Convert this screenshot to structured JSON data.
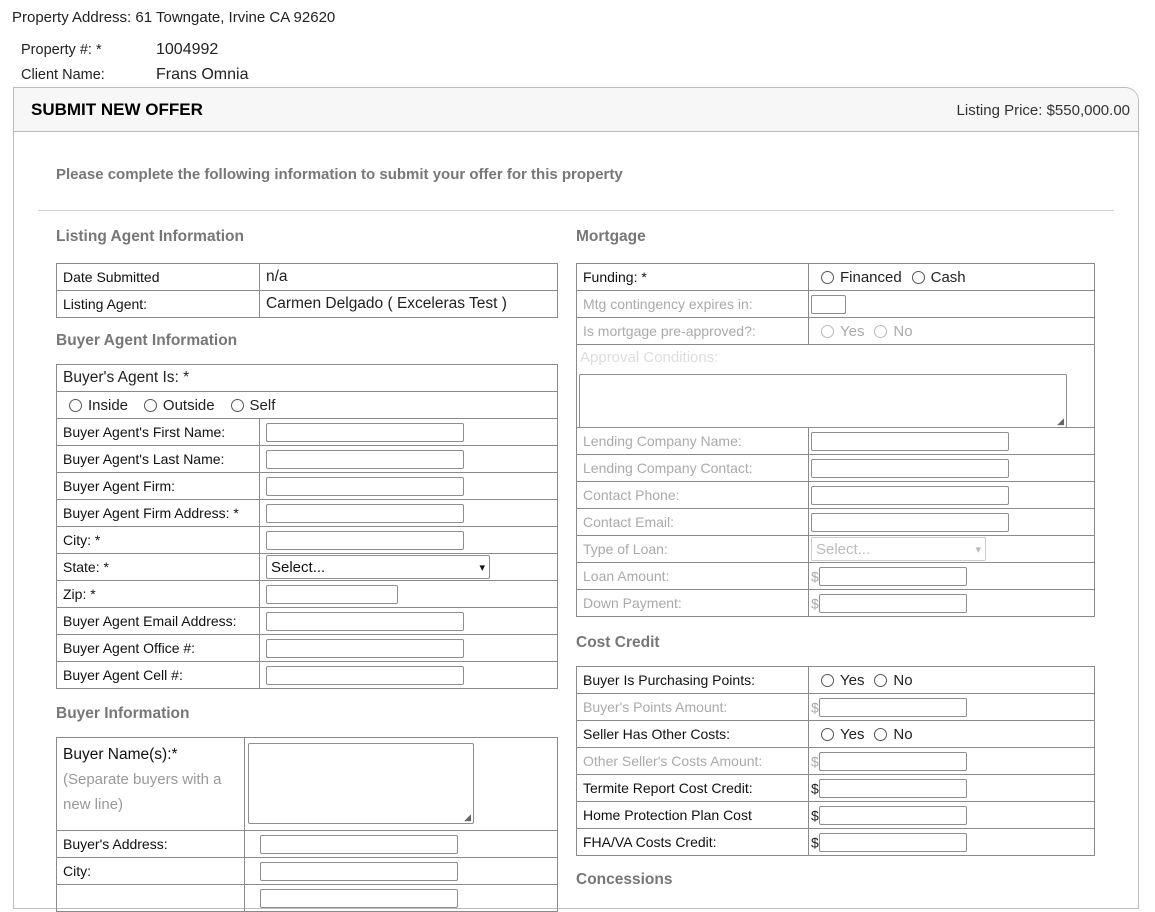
{
  "property": {
    "address_label": "Property Address:",
    "address": "61 Towngate, Irvine CA 92620",
    "number_label": "Property #: *",
    "number": "1004992",
    "client_label": "Client Name:",
    "client": "Frans Omnia"
  },
  "panel": {
    "title": "SUBMIT NEW OFFER",
    "listing_price": "Listing Price: $550,000.00",
    "intro": "Please complete the following information to submit your offer for this property"
  },
  "listing_agent": {
    "heading": "Listing Agent Information",
    "date_label": "Date Submitted",
    "date_value": "n/a",
    "agent_label": "Listing Agent:",
    "agent_value": "Carmen Delgado ( Exceleras Test )"
  },
  "buyer_agent": {
    "heading": "Buyer Agent Information",
    "is_label": "Buyer's Agent Is: *",
    "options": [
      "Inside",
      "Outside",
      "Self"
    ],
    "first_name": "Buyer Agent's First Name:",
    "last_name": "Buyer Agent's Last Name:",
    "firm": "Buyer Agent Firm:",
    "firm_address": "Buyer Agent Firm Address: *",
    "city": "City: *",
    "state": "State: *",
    "state_select": "Select...",
    "zip": "Zip: *",
    "email": "Buyer Agent Email Address:",
    "office": "Buyer Agent Office #:",
    "cell": "Buyer Agent Cell #:"
  },
  "buyer_info": {
    "heading": "Buyer Information",
    "names_label": "Buyer Name(s):*",
    "names_hint": "(Separate buyers with a new line)",
    "address": "Buyer's Address:",
    "city": "City:"
  },
  "mortgage": {
    "heading": "Mortgage",
    "funding_label": "Funding: *",
    "funding_options": [
      "Financed",
      "Cash"
    ],
    "contingency": "Mtg contingency expires in:",
    "preapproved": "Is mortgage pre-approved?:",
    "yes": "Yes",
    "no": "No",
    "approval_conditions": "Approval Conditions:",
    "lending_company": "Lending Company Name:",
    "lending_contact": "Lending Company Contact:",
    "contact_phone": "Contact Phone:",
    "contact_email": "Contact Email:",
    "loan_type": "Type of Loan:",
    "loan_type_select": "Select...",
    "loan_amount": "Loan Amount:",
    "down_payment": "Down Payment:",
    "currency": "$"
  },
  "cost_credit": {
    "heading": "Cost Credit",
    "purchasing_points": "Buyer Is Purchasing Points:",
    "points_amount": "Buyer's Points Amount:",
    "seller_other": "Seller Has Other Costs:",
    "other_amount": "Other Seller's Costs Amount:",
    "termite": "Termite Report Cost Credit:",
    "home_protection": "Home Protection Plan Cost",
    "fha_va": "FHA/VA Costs Credit:",
    "yes": "Yes",
    "no": "No",
    "currency": "$"
  },
  "concessions": {
    "heading": "Concessions"
  },
  "icons": {
    "select_chevron": "chevron-down-icon",
    "textarea_resize": "resize-grip-icon"
  }
}
